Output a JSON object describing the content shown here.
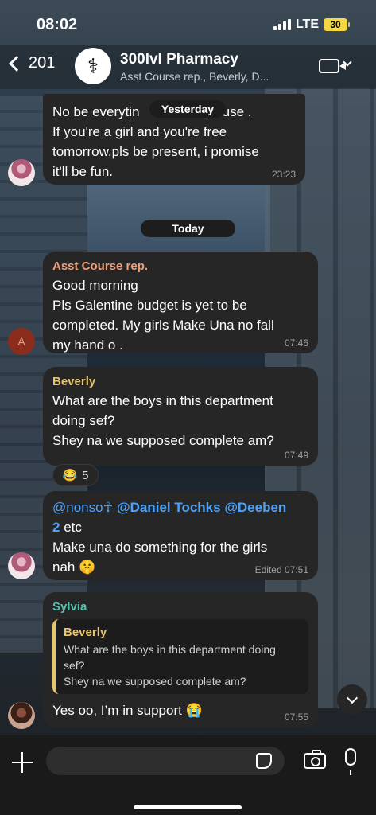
{
  "status_bar": {
    "time": "08:02",
    "network": "LTE",
    "battery": "30"
  },
  "header": {
    "back_count": "201",
    "group_name": "300lvl Pharmacy",
    "members": "Asst Course rep., Beverly, D..."
  },
  "chat": {
    "date_yesterday": "Yesterday",
    "date_today": "Today",
    "msg1": {
      "line1": "No be everytin",
      "line1_end": "use .",
      "line2": "If you're a girl and you're free",
      "line3": "tomorrow.pls be present, i promise",
      "line4": "it'll be fun.",
      "time": "23:23"
    },
    "msg2": {
      "sender": "Asst Course rep.",
      "sender_color": "#f0a07a",
      "avatar_letter": "A",
      "line1": "Good morning",
      "line2": "Pls Galentine budget  is yet to be",
      "line3": "completed. My girls Make Una no fall",
      "line4": "my hand o .",
      "time": "07:46"
    },
    "msg3": {
      "sender": "Beverly",
      "sender_color": "#e7c46e",
      "line1": "What are the boys in this department",
      "line2": "doing sef?",
      "line3": "Shey na we supposed complete am?",
      "time": "07:49",
      "reaction_emoji": "😂",
      "reaction_count": "5"
    },
    "msg4": {
      "mention1": "@nonso☥",
      "mention2": "@Daniel Tochks",
      "mention3": "@Deeben",
      "mention3_cont": "2",
      "etc": "etc",
      "line2": "Make una do something for the girls",
      "line3": "nah 🤫",
      "time": "Edited 07:51"
    },
    "msg5": {
      "sender": "Sylvia",
      "sender_color": "#4fc3b0",
      "quote_sender": "Beverly",
      "quote_line1": "What are the boys in this department doing",
      "quote_line2": "sef?",
      "quote_line3": "Shey na we supposed complete am?",
      "text": "Yes oo, I’m in support 😭",
      "time": "07:55"
    }
  },
  "input": {
    "placeholder": ""
  }
}
